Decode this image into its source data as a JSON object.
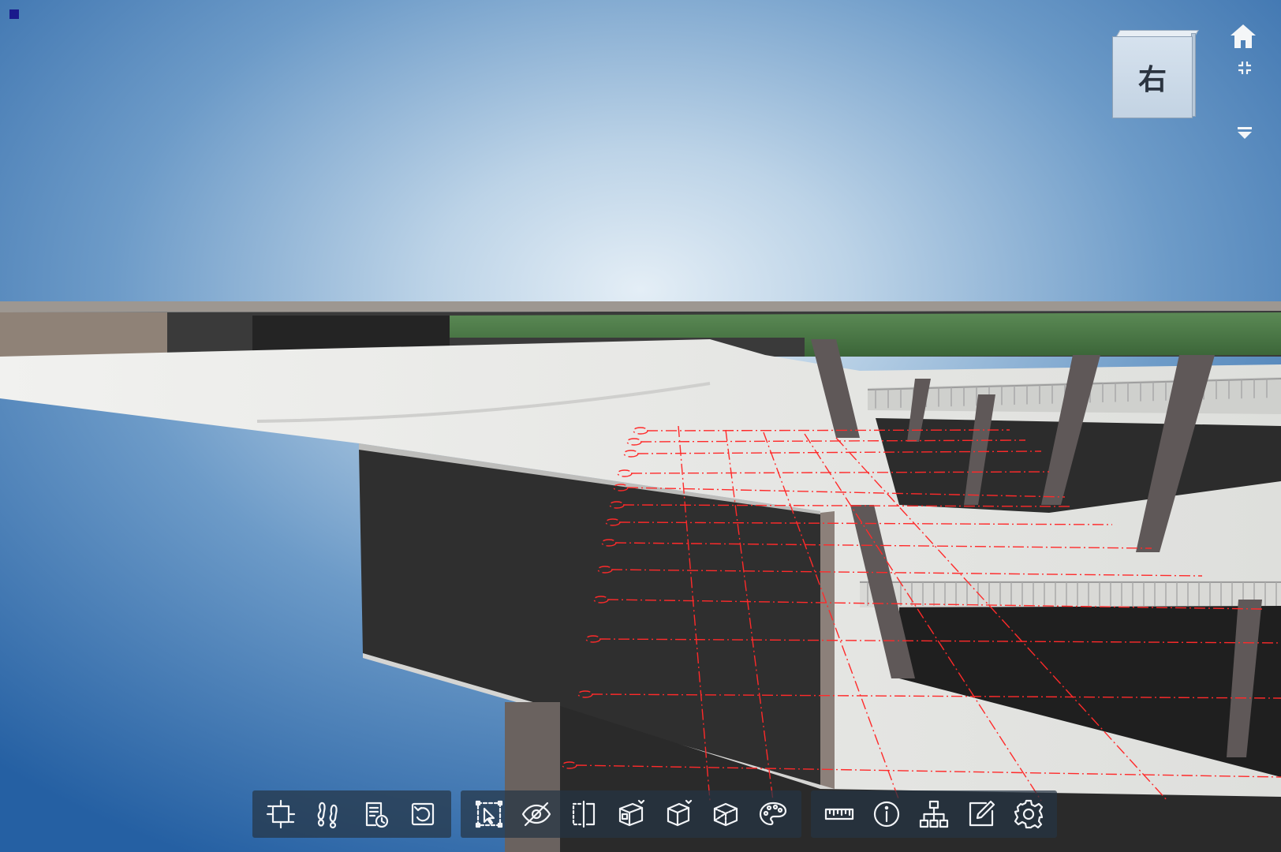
{
  "viewcube": {
    "face_label": "右"
  },
  "side_tools": [
    {
      "id": "home",
      "icon": "home-icon"
    },
    {
      "id": "fit",
      "icon": "fit-view-icon"
    },
    {
      "id": "more",
      "icon": "dropdown-arrow-icon"
    }
  ],
  "toolbar": {
    "groups": [
      [
        {
          "id": "section",
          "icon": "crop-section-icon"
        },
        {
          "id": "walk",
          "icon": "footprints-icon"
        },
        {
          "id": "properties-history",
          "icon": "document-clock-icon"
        },
        {
          "id": "reset",
          "icon": "reset-icon"
        }
      ],
      [
        {
          "id": "box-select",
          "icon": "box-select-icon"
        },
        {
          "id": "hide",
          "icon": "eye-off-icon"
        },
        {
          "id": "split",
          "icon": "split-view-icon"
        },
        {
          "id": "isolate",
          "icon": "cube-isolate-icon"
        },
        {
          "id": "explode",
          "icon": "cube-explode-icon"
        },
        {
          "id": "wireframe",
          "icon": "cube-wireframe-icon"
        },
        {
          "id": "material",
          "icon": "palette-icon"
        }
      ],
      [
        {
          "id": "measure",
          "icon": "ruler-icon"
        },
        {
          "id": "info",
          "icon": "info-icon"
        },
        {
          "id": "structure",
          "icon": "hierarchy-icon"
        },
        {
          "id": "annotate",
          "icon": "edit-icon"
        },
        {
          "id": "settings",
          "icon": "gear-icon"
        }
      ]
    ]
  },
  "colors": {
    "sky_top": "#2f6aa8",
    "sky_center": "#dce9f3",
    "concrete_light": "#e8e9e7",
    "concrete_dark": "#2e2e2e",
    "pillar": "#5d5656",
    "green_roof": "#4a7a46",
    "grid_line": "#ff2a2a"
  }
}
